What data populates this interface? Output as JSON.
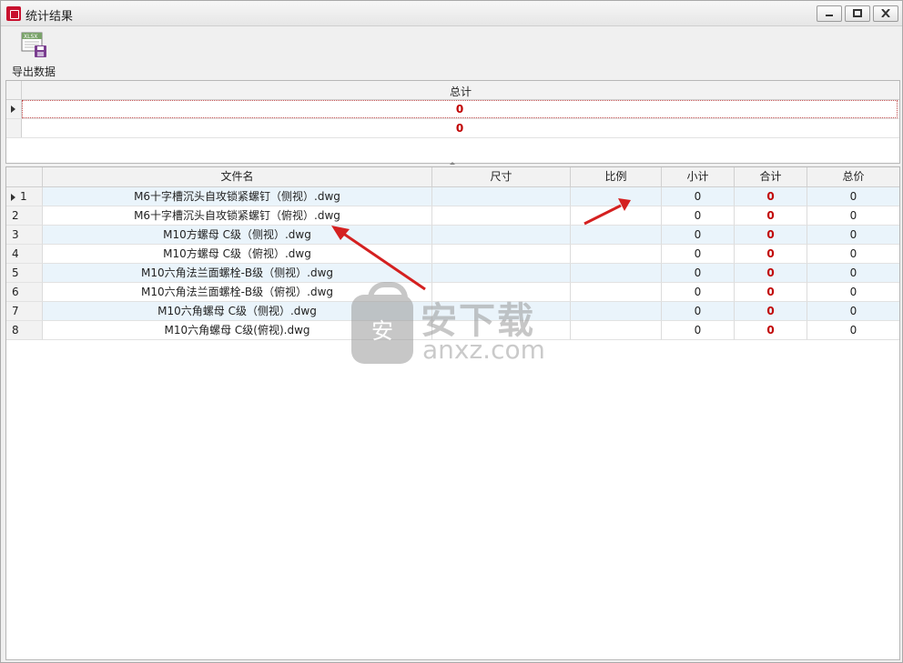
{
  "window": {
    "title": "统计结果"
  },
  "toolbar": {
    "export_label": "导出数据",
    "export_icon_text": "XLSX"
  },
  "summary_grid": {
    "header": "总计",
    "rows": [
      "0",
      "0"
    ]
  },
  "main_grid": {
    "headers": {
      "file": "文件名",
      "size": "尺寸",
      "ratio": "比例",
      "subtotal": "小计",
      "total": "合计",
      "price": "总价"
    },
    "rows": [
      {
        "index": "1",
        "file": "M6十字槽沉头自攻锁紧螺钉（侧视）.dwg",
        "size": "",
        "ratio": "",
        "subtotal": "0",
        "total": "0",
        "price": "0"
      },
      {
        "index": "2",
        "file": "M6十字槽沉头自攻锁紧螺钉（俯视）.dwg",
        "size": "",
        "ratio": "",
        "subtotal": "0",
        "total": "0",
        "price": "0"
      },
      {
        "index": "3",
        "file": "M10方螺母 C级（侧视）.dwg",
        "size": "",
        "ratio": "",
        "subtotal": "0",
        "total": "0",
        "price": "0"
      },
      {
        "index": "4",
        "file": "M10方螺母 C级（俯视）.dwg",
        "size": "",
        "ratio": "",
        "subtotal": "0",
        "total": "0",
        "price": "0"
      },
      {
        "index": "5",
        "file": "M10六角法兰面螺栓-B级（侧视）.dwg",
        "size": "",
        "ratio": "",
        "subtotal": "0",
        "total": "0",
        "price": "0"
      },
      {
        "index": "6",
        "file": "M10六角法兰面螺栓-B级（俯视）.dwg",
        "size": "",
        "ratio": "",
        "subtotal": "0",
        "total": "0",
        "price": "0"
      },
      {
        "index": "7",
        "file": "M10六角螺母 C级（侧视）.dwg",
        "size": "",
        "ratio": "",
        "subtotal": "0",
        "total": "0",
        "price": "0"
      },
      {
        "index": "8",
        "file": "M10六角螺母 C级(俯视).dwg",
        "size": "",
        "ratio": "",
        "subtotal": "0",
        "total": "0",
        "price": "0"
      }
    ]
  },
  "watermark": {
    "cn": "安下载",
    "en": "anxz.com",
    "shield_char": "安"
  },
  "colors": {
    "accent_red": "#c00000",
    "row_alt": "#eaf4fb",
    "arrow": "#d42020"
  }
}
